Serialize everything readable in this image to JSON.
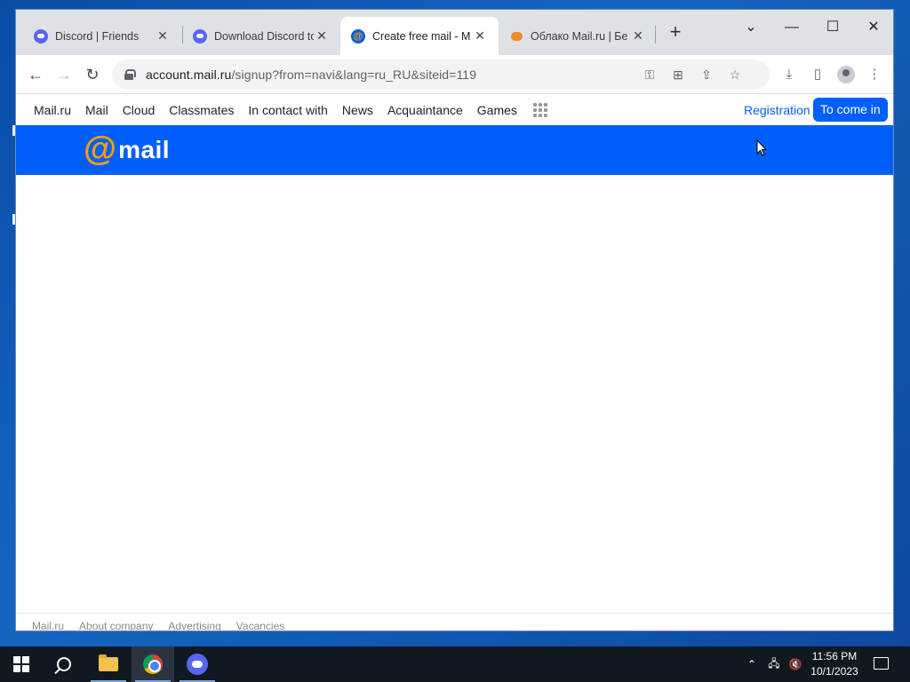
{
  "browser": {
    "tabs": [
      {
        "title": "Discord | Friends",
        "favicon": "discord-icon",
        "active": false
      },
      {
        "title": "Download Discord to",
        "favicon": "discord-icon",
        "active": false
      },
      {
        "title": "Create free mail - M",
        "favicon": "mail-ru-icon",
        "active": true
      },
      {
        "title": "Облако Mail.ru | Бе",
        "favicon": "cloud-icon",
        "active": false
      }
    ],
    "new_tab_label": "+",
    "address": {
      "host": "account.mail.ru",
      "path": "/signup?from=navi&lang=ru_RU&siteid=119"
    }
  },
  "page": {
    "portal_nav": [
      "Mail.ru",
      "Mail",
      "Cloud",
      "Classmates",
      "In contact with",
      "News",
      "Acquaintance",
      "Games"
    ],
    "registration_label": "Registration",
    "login_label": "To come in",
    "logo": {
      "symbol": "@",
      "text": "mail"
    },
    "footer_links": [
      "Mail.ru",
      "About company",
      "Advertising",
      "Vacancies"
    ],
    "colors": {
      "brand_blue": "#005ff9",
      "logo_orange": "#ff9e00"
    }
  },
  "taskbar": {
    "time": "11:56 PM",
    "date": "10/1/2023"
  }
}
